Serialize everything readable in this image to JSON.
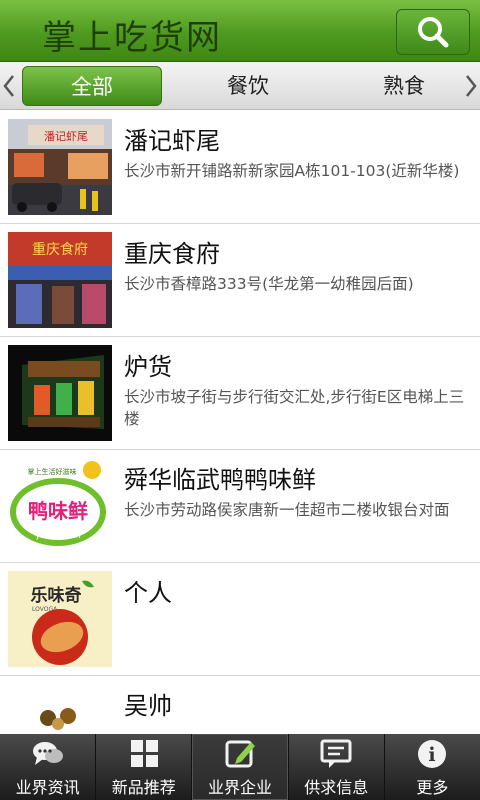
{
  "header": {
    "title": "掌上吃货网"
  },
  "categories": [
    {
      "label": "全部"
    },
    {
      "label": "餐饮"
    },
    {
      "label": "熟食"
    }
  ],
  "listings": [
    {
      "name": "潘记虾尾",
      "address": "长沙市新开铺路新新家园A栋101-103(近新华楼)",
      "thumb_text": "潘记虾尾"
    },
    {
      "name": "重庆食府",
      "address": "长沙市香樟路333号(华龙第一幼稚园后面)",
      "thumb_text": "重庆食府"
    },
    {
      "name": "炉货",
      "address": "长沙市坡子街与步行街交汇处,步行街E区电梯上三楼",
      "thumb_text": ""
    },
    {
      "name": "舜华临武鸭鸭味鲜",
      "address": "长沙市劳动路侯家唐新一佳超市二楼收银台对面",
      "thumb_text": "鸭味鲜",
      "thumb_sub": "ya wei xian",
      "thumb_top": "掌上生活好滋味"
    },
    {
      "name": "个人",
      "address": "",
      "thumb_text": "乐味奇",
      "thumb_sub": "LOVOGA"
    },
    {
      "name": "吴帅",
      "address": "",
      "thumb_text": ""
    }
  ],
  "nav": [
    {
      "label": "业界资讯",
      "icon": "chat-bubbles-icon"
    },
    {
      "label": "新品推荐",
      "icon": "grid-icon"
    },
    {
      "label": "业界企业",
      "icon": "edit-icon"
    },
    {
      "label": "供求信息",
      "icon": "message-icon"
    },
    {
      "label": "更多",
      "icon": "info-icon"
    }
  ],
  "colors": {
    "brand_green": "#4e9a1f",
    "nav_dark": "#2a2a2a"
  }
}
